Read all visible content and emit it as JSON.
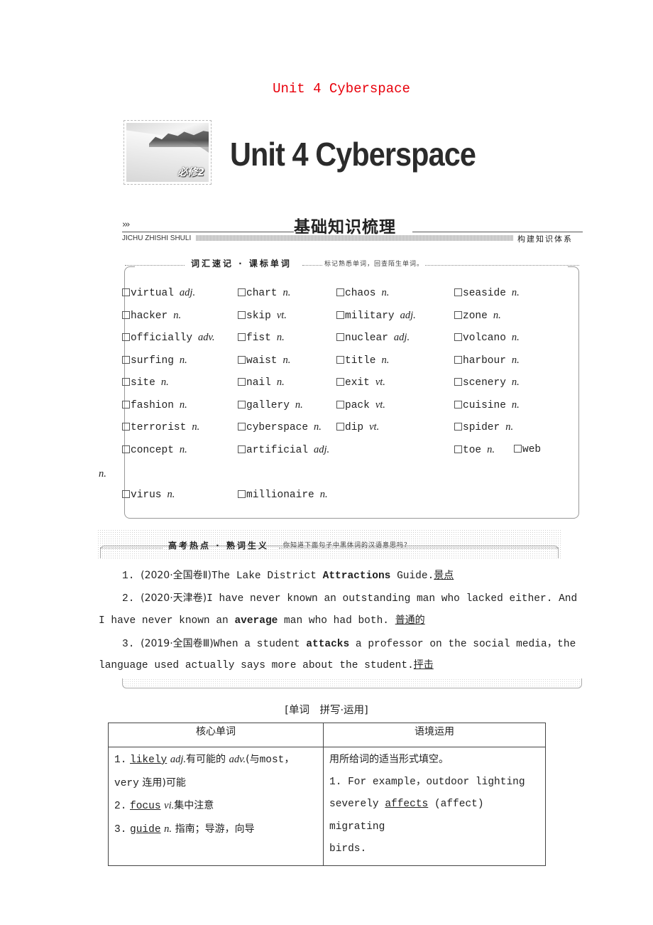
{
  "page_title": "Unit 4 Cyberspace",
  "banner": {
    "thumbnail_badge": "必修2",
    "title": "Unit 4  Cyberspace"
  },
  "section": {
    "arrows": "›››",
    "title": "基础知识梳理",
    "pinyin": "JICHU ZHISHI SHULI",
    "subtitle": "构建知识体系"
  },
  "vocab_box": {
    "label": "词汇速记 · 课标单词",
    "hint": "标记熟悉单词，回查陌生单词。",
    "words": [
      {
        "word": "virtual",
        "pos": "adj."
      },
      {
        "word": "chart",
        "pos": "n."
      },
      {
        "word": "chaos",
        "pos": "n."
      },
      {
        "word": "seaside",
        "pos": "n."
      },
      {
        "word": "hacker",
        "pos": "n."
      },
      {
        "word": "skip",
        "pos": "vt."
      },
      {
        "word": "military",
        "pos": "adj."
      },
      {
        "word": "zone",
        "pos": "n."
      },
      {
        "word": "officially",
        "pos": "adv."
      },
      {
        "word": "fist",
        "pos": "n."
      },
      {
        "word": "nuclear",
        "pos": "adj."
      },
      {
        "word": "volcano",
        "pos": "n."
      },
      {
        "word": "surfing",
        "pos": "n."
      },
      {
        "word": "waist",
        "pos": "n."
      },
      {
        "word": "title",
        "pos": "n."
      },
      {
        "word": "harbour",
        "pos": "n."
      },
      {
        "word": "site",
        "pos": "n."
      },
      {
        "word": "nail",
        "pos": "n."
      },
      {
        "word": "exit",
        "pos": "vt."
      },
      {
        "word": "scenery",
        "pos": "n."
      },
      {
        "word": "fashion",
        "pos": "n."
      },
      {
        "word": "gallery",
        "pos": "n."
      },
      {
        "word": "pack",
        "pos": "vt."
      },
      {
        "word": "cuisine",
        "pos": "n."
      },
      {
        "word": "terrorist",
        "pos": "n."
      },
      {
        "word": "cyberspace",
        "pos": "n."
      },
      {
        "word": "dip",
        "pos": "vt."
      },
      {
        "word": "spider",
        "pos": "n."
      },
      {
        "word": "concept",
        "pos": "n."
      },
      {
        "word": "artificial",
        "pos": "adj."
      },
      {
        "word": "toe",
        "pos": "n."
      },
      {
        "word": "web",
        "pos": ""
      },
      {
        "word": "virus",
        "pos": "n."
      },
      {
        "word": "millionaire",
        "pos": "n."
      }
    ],
    "wrapped_pos": "n."
  },
  "hot_box": {
    "label": "高考热点 · 熟词生义",
    "hint": "你知道下面句子中黑体词的汉语意思吗？",
    "items": [
      {
        "num": "1.",
        "source": "(2020·全国卷Ⅱ)",
        "before": "The Lake District ",
        "bold": "Attractions",
        "after": " Guide.",
        "answer": "景点"
      },
      {
        "num": "2.",
        "source": "(2020·天津卷)",
        "line1": "I have never known an outstanding man who lacked either. And",
        "line2_before": "I have never known an ",
        "bold": "average",
        "line2_after": " man who had both. ",
        "answer": "普通的"
      },
      {
        "num": "3.",
        "source": "(2019·全国卷Ⅲ)",
        "before": "When a student ",
        "bold": "attacks",
        "after": " a professor on the social media，the",
        "line2": "language used actually says more about the student.",
        "answer": "抨击"
      }
    ]
  },
  "table": {
    "caption": "[单词　拼写·运用]",
    "headers": [
      "核心单词",
      "语境运用"
    ],
    "left_entries": [
      {
        "num": "1.",
        "word": "likely",
        "pos": "adj.",
        "meaning": "有可能的",
        "pos2": "adv.",
        "meaning2_prefix": "(与",
        "meaning2_mono": "most，",
        "line2_mono": "very",
        "line2_cn": "连用)可能"
      },
      {
        "num": "2.",
        "word": "focus",
        "pos": "vi.",
        "meaning": "集中注意"
      },
      {
        "num": "3.",
        "word": "guide",
        "pos": "n.",
        "meaning": "指南；导游，向导"
      }
    ],
    "right": {
      "instruction": "用所给词的适当形式填空。",
      "sentence_line1": "1. For example，outdoor lighting",
      "sentence_before": "severely ",
      "answer": "affects",
      "sentence_after": " (affect) migrating",
      "sentence_line3": "birds."
    }
  }
}
